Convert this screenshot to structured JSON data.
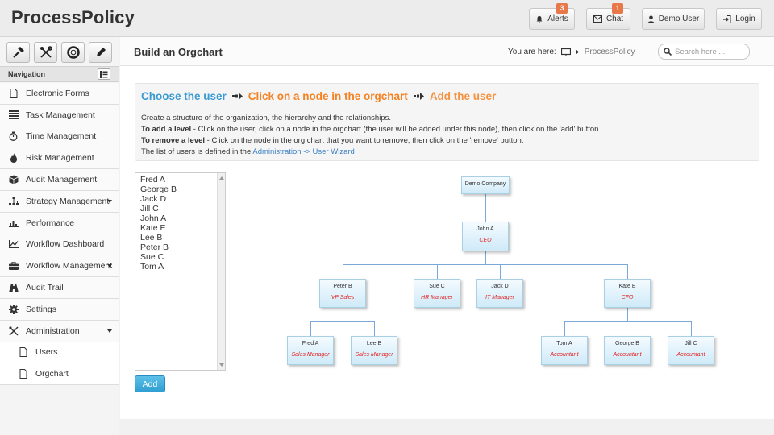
{
  "app": {
    "title": "ProcessPolicy"
  },
  "header": {
    "alerts": {
      "label": "Alerts",
      "count": "3"
    },
    "chat": {
      "label": "Chat",
      "count": "1"
    },
    "user": {
      "label": "Demo User"
    },
    "login": {
      "label": "Login"
    }
  },
  "sidebar": {
    "nav_label": "Navigation",
    "tools": [
      "hammer-icon",
      "tools-icon",
      "lifebuoy-icon",
      "pencil-icon"
    ],
    "items": [
      {
        "label": "Electronic Forms",
        "icon": "file-icon"
      },
      {
        "label": "Task Management",
        "icon": "list-icon"
      },
      {
        "label": "Time Management",
        "icon": "stopwatch-icon"
      },
      {
        "label": "Risk Management",
        "icon": "fire-icon"
      },
      {
        "label": "Audit Management",
        "icon": "cube-icon"
      },
      {
        "label": "Strategy Management",
        "icon": "sitemap-icon"
      },
      {
        "label": "Performance",
        "icon": "bar-chart-icon"
      },
      {
        "label": "Workflow Dashboard",
        "icon": "line-chart-icon"
      },
      {
        "label": "Workflow Management",
        "icon": "briefcase-icon"
      },
      {
        "label": "Audit Trail",
        "icon": "road-icon"
      },
      {
        "label": "Settings",
        "icon": "gear-icon"
      },
      {
        "label": "Administration",
        "icon": "tools-icon"
      },
      {
        "label": "Users",
        "icon": "file-icon"
      },
      {
        "label": "Orgchart",
        "icon": "file-icon"
      }
    ]
  },
  "page": {
    "title": "Build an Orgchart",
    "breadcrumb": {
      "prefix": "You are here:",
      "current": "ProcessPolicy"
    },
    "search": {
      "placeholder": "Search here ..."
    }
  },
  "instructions": {
    "step1": "Choose the user",
    "step2": "Click on a node in the orgchart",
    "step3": "Add the user",
    "line1": "Create a structure of the organization, the hierarchy and the relationships.",
    "line2_bold": "To add a level",
    "line2": " - Click on the user, click on a node in the orgchart (the user will be added under this node), then click on the 'add' button.",
    "line3_bold": "To remove a level",
    "line3": " - Click on the node in the org chart that you want to remove, then click on the 'remove' button.",
    "line4": "The list of users is defined in the ",
    "line4_link": "Administration -> User Wizard"
  },
  "users": [
    "Fred A",
    "George B",
    "Jack D",
    "Jill C",
    "John A",
    "Kate E",
    "Lee B",
    "Peter B",
    "Sue C",
    "Tom A"
  ],
  "add_label": "Add",
  "org": {
    "company": {
      "name": "Demo Company"
    },
    "ceo": {
      "name": "John A",
      "role": "CEO"
    },
    "peter": {
      "name": "Peter B",
      "role": "VP Sales"
    },
    "sue": {
      "name": "Sue C",
      "role": "HR Manager"
    },
    "jack": {
      "name": "Jack D",
      "role": "IT Manager"
    },
    "kate": {
      "name": "Kate E",
      "role": "CFO"
    },
    "fred": {
      "name": "Fred A",
      "role": "Sales Manager"
    },
    "lee": {
      "name": "Lee B",
      "role": "Sales Manager"
    },
    "tom": {
      "name": "Tom A",
      "role": "Accountant"
    },
    "george": {
      "name": "George B",
      "role": "Accountant"
    },
    "jill": {
      "name": "Jill C",
      "role": "Accountant"
    }
  }
}
